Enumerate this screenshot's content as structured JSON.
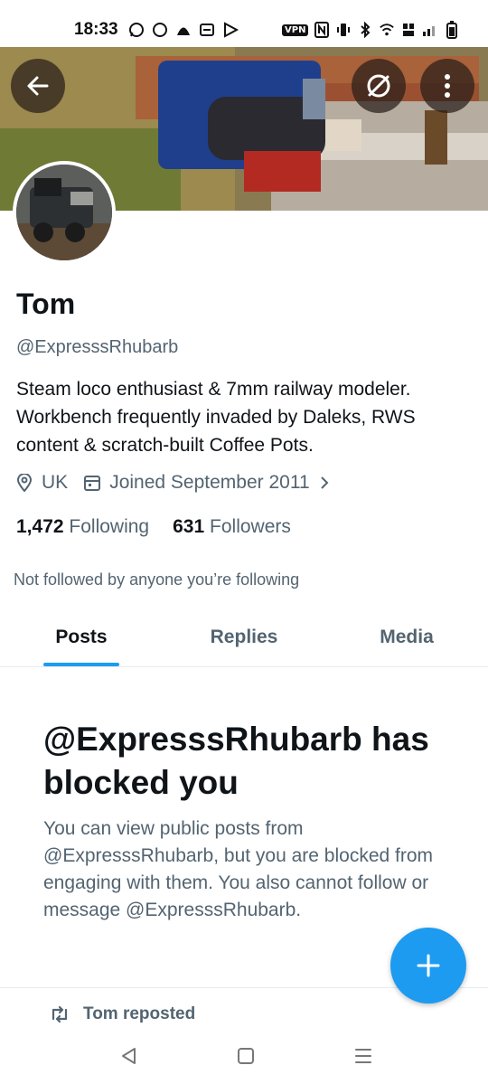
{
  "status_bar": {
    "time": "18:33",
    "left_icons": [
      "whatsapp-icon",
      "chat-bubble-icon",
      "app-icon",
      "calendar-icon",
      "play-store-icon"
    ],
    "vpn_label": "VPN",
    "right_icons": [
      "nfc-icon",
      "vibrate-icon",
      "bluetooth-icon",
      "wifi-icon",
      "volte-icon",
      "signal-icon",
      "battery-icon"
    ]
  },
  "header": {
    "back_icon": "arrow-left-icon",
    "grok_icon": "grok-icon",
    "more_icon": "more-vertical-icon"
  },
  "profile": {
    "display_name": "Tom",
    "handle": "@ExpresssRhubarb",
    "bio": "Steam loco enthusiast & 7mm railway modeler.\nWorkbench frequently invaded by Daleks, RWS\ncontent & scratch-built Coffee Pots.",
    "location": "UK",
    "joined": "Joined September 2011",
    "following_count": "1,472",
    "following_label": "Following",
    "followers_count": "631",
    "followers_label": "Followers",
    "not_followed_text": "Not followed by anyone you’re following"
  },
  "tabs": [
    {
      "label": "Posts",
      "active": true
    },
    {
      "label": "Replies",
      "active": false
    },
    {
      "label": "Media",
      "active": false
    }
  ],
  "blocked": {
    "title": "@ExpresssRhubarb has blocked you",
    "description": "You can view public posts from @ExpresssRhubarb, but you are blocked from engaging with them. You also cannot follow or message @ExpresssRhubarb."
  },
  "repost": {
    "text": "Tom reposted"
  },
  "colors": {
    "accent": "#1d9bf0",
    "text_primary": "#0f1419",
    "text_secondary": "#536471"
  }
}
